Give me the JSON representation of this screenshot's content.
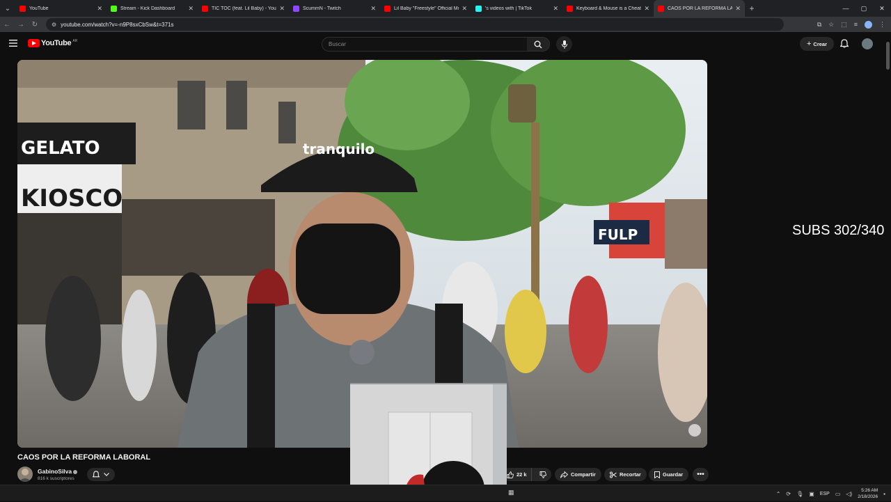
{
  "browser": {
    "tabs": [
      {
        "title": "YouTube",
        "favicon_color": "#ff0000"
      },
      {
        "title": "Stream - Kick Dashboard",
        "favicon_color": "#53fc18"
      },
      {
        "title": "TIC TOC (feat. Lil Baby) - YouTube",
        "favicon_color": "#ff0000"
      },
      {
        "title": "ScummN - Twitch",
        "favicon_color": "#9146ff"
      },
      {
        "title": "Lil Baby \"Freestyle\" Official Music",
        "favicon_color": "#ff0000"
      },
      {
        "title": "'s videos with | TikTok",
        "favicon_color": "#25f4ee"
      },
      {
        "title": "Keyboard & Mouse is a Cheat C",
        "favicon_color": "#ff0000"
      },
      {
        "title": "CAOS POR LA REFORMA LA",
        "favicon_color": "#ff0000",
        "active": true
      }
    ],
    "url": "youtube.com/watch?v=-n9P8sxCbSw&t=371s"
  },
  "youtube": {
    "logo_text": "YouTube",
    "country_code": "AR",
    "search_placeholder": "Buscar",
    "create_label": "Crear"
  },
  "video": {
    "title": "CAOS POR LA REFORMA LABORAL",
    "overlay_text": "SUBS 302/340",
    "channel_name": "GabinoSilva",
    "channel_subs": "816 k suscriptores",
    "like_count": "22 k",
    "share_label": "Compartir",
    "clip_label": "Recortar",
    "save_label": "Guardar"
  },
  "taskbar": {
    "language": "ESP",
    "time": "5:26 AM",
    "date": "2/18/2026"
  }
}
